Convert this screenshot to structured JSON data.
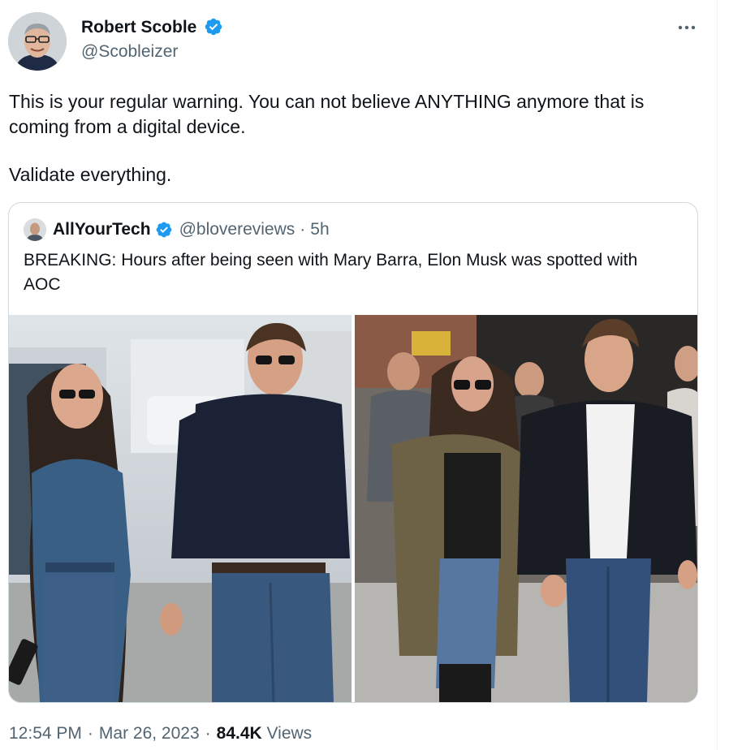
{
  "author": {
    "display_name": "Robert Scoble",
    "handle": "@Scobleizer",
    "verified_icon": "verified-badge-icon",
    "badge_color": "#1d9bf0"
  },
  "more_icon": "more-horizontal-icon",
  "tweet": {
    "line1": "This is your regular warning. You can not believe ANYTHING anymore that is coming from a digital device.",
    "line2": "Validate everything."
  },
  "quoted": {
    "display_name": "AllYourTech",
    "handle": "@blovereviews",
    "separator": "·",
    "time": "5h",
    "text": "BREAKING: Hours after being seen with Mary Barra, Elon Musk was spotted with AOC"
  },
  "meta": {
    "time": "12:54 PM",
    "separator": "·",
    "date": "Mar 26, 2023",
    "views_count": "84.4K",
    "views_label": "Views"
  }
}
